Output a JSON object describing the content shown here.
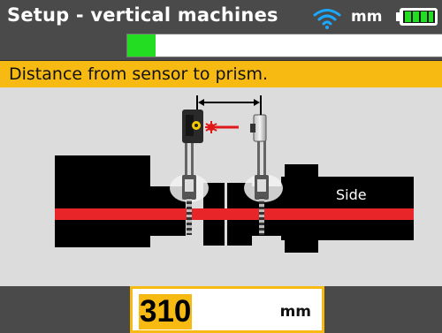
{
  "header": {
    "title": "Setup - vertical machines",
    "unit": "mm",
    "icons": {
      "wifi": "wifi-icon",
      "battery": "battery-icon"
    },
    "progress_fraction": 0.09
  },
  "instruction": {
    "text": "Distance from sensor to prism."
  },
  "diagram": {
    "side_label": "Side",
    "colors": {
      "shaft_axis": "#e8262a",
      "machine": "#000000",
      "laser": "#e01818",
      "background": "#dcdcdc"
    }
  },
  "measurement": {
    "value": "310",
    "unit": "mm"
  },
  "colors": {
    "accent": "#f6ba12",
    "header_bg": "#4a4a4a",
    "progress": "#22dd22"
  }
}
